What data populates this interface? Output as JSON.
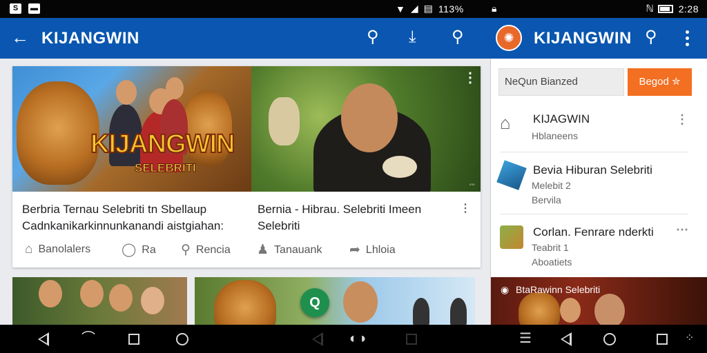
{
  "status_bar": {
    "battery_text": "113%",
    "time": "2:28",
    "left_icons": [
      "sim-icon",
      "message-icon"
    ]
  },
  "app_bar": {
    "title_left": "KIJANGWIN",
    "title_right": "KIJANGWIN",
    "accent_color": "#0a56b0",
    "icons": [
      "back-arrow-icon",
      "search-icon",
      "download-icon",
      "search-icon",
      "logo-icon",
      "search-icon",
      "more-vert-icon"
    ]
  },
  "feed": {
    "card": {
      "banner_text": "KIJANGWIN",
      "banner_sub": "SELEBRITI",
      "caption_left": "Berbria Ternau Selebriti tn Sbellaup Cadnkanikarkinnunkanandi aistgiahan:",
      "caption_right": "Bernia - Hibrau. Selebriti Imeen Selebriti",
      "actions": [
        {
          "icon": "like-icon",
          "label": "Banolalers"
        },
        {
          "icon": "comment-icon",
          "label": "Ra"
        },
        {
          "icon": "search-comment-icon",
          "label": "Rencia"
        },
        {
          "icon": "user-icon",
          "label": "Tanauank"
        },
        {
          "icon": "share-icon",
          "label": "Lhloia"
        }
      ]
    },
    "fab_label": "Q"
  },
  "panel": {
    "search_placeholder": "NeQun Bianzed",
    "go_label": "Begod ✮",
    "go_color": "#f36f21",
    "items": [
      {
        "title": "KIJAGWIN",
        "sub1": "Hblaneens",
        "sub2": ""
      },
      {
        "title": "Bevia Hiburan Selebriti",
        "sub1": "Melebit 2",
        "sub2": "Bervila"
      },
      {
        "title": "Corlan. Fenrare nderkti",
        "sub1": "Teabrit 1",
        "sub2": "Aboatiets"
      }
    ],
    "image_title": "BtaRawinn Selebriti"
  },
  "nav_bar": {
    "icons": [
      "back-icon",
      "recents-icon",
      "home-icon",
      "circle-icon",
      "back-icon",
      "home-icon",
      "recents-icon",
      "menu-icon",
      "back-icon",
      "home-icon",
      "recents-icon",
      "dots-icon"
    ]
  }
}
